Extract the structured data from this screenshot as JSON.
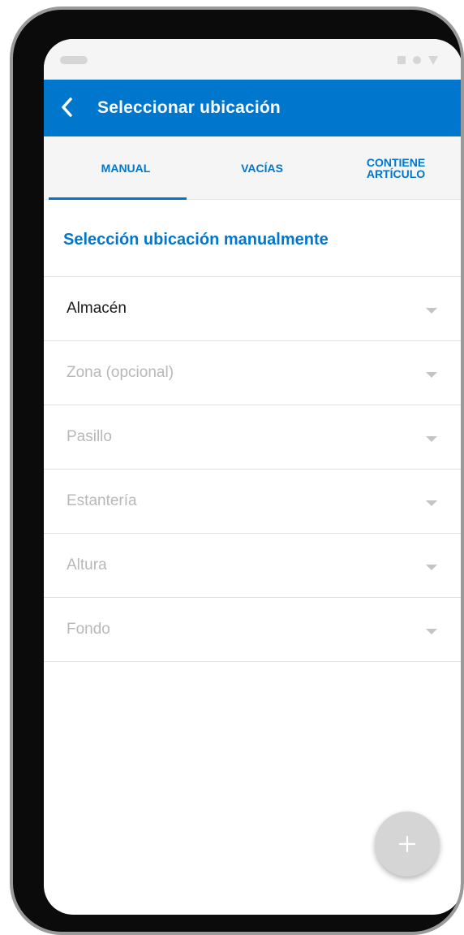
{
  "app_bar": {
    "title": "Seleccionar ubicación",
    "color": "#0077cc"
  },
  "tabs": [
    {
      "label_line1": "MANUAL",
      "label_line2": "",
      "active": true
    },
    {
      "label_line1": "VACÍAS",
      "label_line2": "",
      "active": false
    },
    {
      "label_line1": "CONTIENE",
      "label_line2": "ARTÍCULO",
      "active": false
    }
  ],
  "section": {
    "title": "Selección ubicación manualmente"
  },
  "fields": [
    {
      "label": "Almacén",
      "filled": true
    },
    {
      "label": "Zona (opcional)",
      "filled": false
    },
    {
      "label": "Pasillo",
      "filled": false
    },
    {
      "label": "Estantería",
      "filled": false
    },
    {
      "label": "Altura",
      "filled": false
    },
    {
      "label": "Fondo",
      "filled": false
    }
  ],
  "icons": {
    "back": "chevron-left-icon",
    "dropdown": "caret-down-icon",
    "fab": "plus-icon"
  },
  "colors": {
    "accent": "#0077cc",
    "placeholder": "#b8b8b8",
    "fab": "#d5d5d5"
  }
}
